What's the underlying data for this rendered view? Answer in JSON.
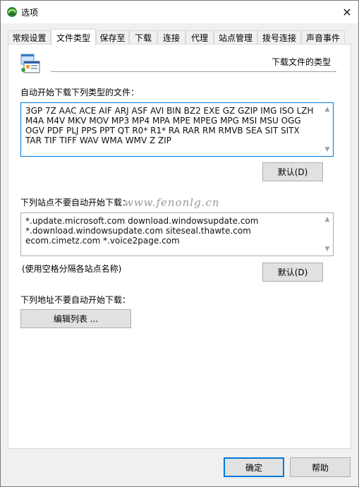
{
  "window": {
    "title": "选项"
  },
  "tabs": [
    {
      "label": "常规设置",
      "active": false
    },
    {
      "label": "文件类型",
      "active": true
    },
    {
      "label": "保存至",
      "active": false
    },
    {
      "label": "下载",
      "active": false
    },
    {
      "label": "连接",
      "active": false
    },
    {
      "label": "代理",
      "active": false
    },
    {
      "label": "站点管理",
      "active": false
    },
    {
      "label": "拨号连接",
      "active": false
    },
    {
      "label": "声音事件",
      "active": false
    }
  ],
  "header": {
    "section_title": "下载文件的类型"
  },
  "file_types": {
    "label": "自动开始下载下列类型的文件：",
    "value": "3GP 7Z AAC ACE AIF ARJ ASF AVI BIN BZ2 EXE GZ GZIP IMG ISO LZH M4A M4V MKV MOV MP3 MP4 MPA MPE MPEG MPG MSI MSU OGG OGV PDF PLJ PPS PPT QT R0* R1* RA RAR RM RMVB SEA SIT SITX TAR TIF TIFF WAV WMA WMV Z ZIP",
    "default_button": "默认(D)"
  },
  "excluded_sites": {
    "label": "下列站点不要自动开始下载：",
    "value": "*.update.microsoft.com download.windowsupdate.com *.download.windowsupdate.com siteseal.thawte.com ecom.cimetz.com *.voice2page.com",
    "hint": "(使用空格分隔各站点名称)",
    "default_button": "默认(D)"
  },
  "excluded_addresses": {
    "label": "下列地址不要自动开始下载：",
    "edit_button": "编辑列表 ..."
  },
  "footer": {
    "ok": "确定",
    "help": "帮助"
  },
  "watermark": "www.fenonlg.cn",
  "colors": {
    "accent": "#0078d7",
    "tab_border": "#d9d9d9",
    "button_bg": "#e1e1e1"
  }
}
